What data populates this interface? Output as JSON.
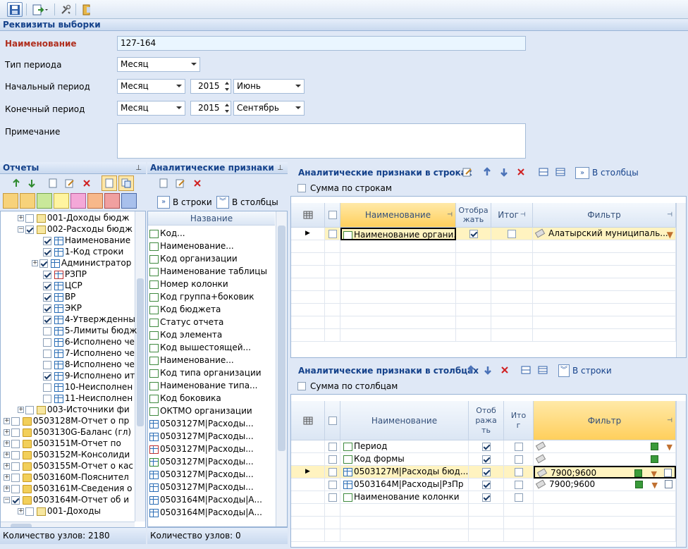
{
  "requisites": {
    "title": "Реквизиты выборки",
    "name_label": "Наименование",
    "name_value": "127-164",
    "period_type_label": "Тип периода",
    "period_type_value": "Месяц",
    "start_label": "Начальный период",
    "start_type": "Месяц",
    "start_year": "2015",
    "start_month": "Июнь",
    "end_label": "Конечный период",
    "end_type": "Месяц",
    "end_year": "2015",
    "end_month": "Сентябрь",
    "note_label": "Примечание"
  },
  "reports": {
    "title": "Отчеты",
    "status": "Количество узлов: 2180",
    "items": [
      {
        "label": "001-Доходы бюдж"
      },
      {
        "label": "002-Расходы бюдж"
      },
      {
        "label": "Наименование"
      },
      {
        "label": "1-Код строки"
      },
      {
        "label": "Администратор"
      },
      {
        "label": "РЗПР"
      },
      {
        "label": "ЦСР"
      },
      {
        "label": "ВР"
      },
      {
        "label": "ЭКР"
      },
      {
        "label": "4-Утвержденны"
      },
      {
        "label": "5-Лимиты бюдж"
      },
      {
        "label": "6-Исполнено че"
      },
      {
        "label": "7-Исполнено че"
      },
      {
        "label": "8-Исполнено че"
      },
      {
        "label": "9-Исполнено ит"
      },
      {
        "label": "10-Неисполнен"
      },
      {
        "label": "11-Неисполнен"
      },
      {
        "label": "003-Источники фи"
      },
      {
        "label": "0503128М-Отчет о пр"
      },
      {
        "label": "0503130G-Баланс (гл)"
      },
      {
        "label": "0503151М-Отчет по"
      },
      {
        "label": "0503152М-Консолиди"
      },
      {
        "label": "0503155М-Отчет о кас"
      },
      {
        "label": "0503160М-Пояснител"
      },
      {
        "label": "0503161М-Сведения о"
      },
      {
        "label": "0503164М-Отчет об и"
      },
      {
        "label": "001-Доходы"
      }
    ]
  },
  "attrs": {
    "title": "Аналитические признаки",
    "to_rows": "В строки",
    "to_cols": "В столбцы",
    "col_header": "Название",
    "status": "Количество узлов: 0",
    "items": [
      {
        "label": "Код..."
      },
      {
        "label": "Наименование..."
      },
      {
        "label": "Код организации"
      },
      {
        "label": "Наименование таблицы"
      },
      {
        "label": "Номер колонки"
      },
      {
        "label": "Код группа+боковик"
      },
      {
        "label": "Код бюджета"
      },
      {
        "label": "Статус отчета"
      },
      {
        "label": "Код элемента"
      },
      {
        "label": "Код вышестоящей..."
      },
      {
        "label": "Наименование..."
      },
      {
        "label": "Код типа организации"
      },
      {
        "label": "Наименование типа..."
      },
      {
        "label": "Код боковика"
      },
      {
        "label": "ОКТМО организации"
      },
      {
        "label": "0503127М|Расходы..."
      },
      {
        "label": "0503127М|Расходы..."
      },
      {
        "label": "0503127М|Расходы..."
      },
      {
        "label": "0503127М|Расходы..."
      },
      {
        "label": "0503127М|Расходы..."
      },
      {
        "label": "0503127М|Расходы..."
      },
      {
        "label": "0503164М|Расходы|А..."
      },
      {
        "label": "0503164М|Расходы|А..."
      }
    ]
  },
  "rows_panel": {
    "title": "Аналитические признаки в строках",
    "to_cols": "В столбцы",
    "sum_label": "Сумма по строкам",
    "col_name": "Наименование",
    "col_show": "Отобра жать",
    "col_total": "Итог",
    "col_filter": "Фильтр",
    "row1_name": "Наименование органи...",
    "row1_filter": "Алатырский муниципаль..."
  },
  "cols_panel": {
    "title": "Аналитические признаки в столбцах",
    "to_rows": "В строки",
    "sum_label": "Сумма по столбцам",
    "col_name": "Наименование",
    "col_show": "Отоб ража ть",
    "col_total": "Ито г",
    "col_filter": "Фильтр",
    "rows": [
      {
        "name": "Период",
        "filter": ""
      },
      {
        "name": "Код формы",
        "filter": ""
      },
      {
        "name": "0503127М|Расходы бюд...",
        "filter": "7900;9600"
      },
      {
        "name": "0503164М|Расходы|РзПр",
        "filter": "7900;9600"
      },
      {
        "name": "Наименование колонки",
        "filter": ""
      }
    ]
  }
}
